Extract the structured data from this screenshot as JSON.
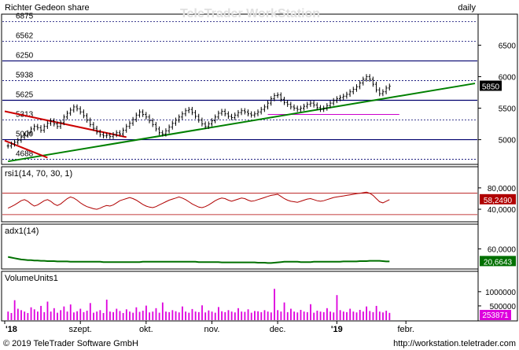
{
  "watermark": "TeleTrader WorkStation",
  "footer": {
    "copyright": "© 2019 TeleTrader Software GmbH",
    "url": "http://workstation.teletrader.com"
  },
  "colors": {
    "price_line": "#000000",
    "trend_green": "#008000",
    "trend_red": "#cc0000",
    "horiz_navy": "#00006e",
    "horiz_magenta": "#cc00cc",
    "rsi": "#b00000",
    "adx": "#007000",
    "volume": "#dd00dd"
  },
  "chart_data": [
    {
      "type": "line",
      "title": "Richter Gedeon share",
      "period": "daily",
      "x_ticks": [
        {
          "label": "'18",
          "day": 0
        },
        {
          "label": "szept.",
          "day": 23
        },
        {
          "label": "okt.",
          "day": 43
        },
        {
          "label": "nov.",
          "day": 63
        },
        {
          "label": "dec.",
          "day": 83
        },
        {
          "label": "'19",
          "day": 101
        },
        {
          "label": "febr.",
          "day": 122
        }
      ],
      "y_ticks_right": [
        5000,
        5500,
        6000,
        6500
      ],
      "ylim": [
        4620,
        6980
      ],
      "horizontal_levels": [
        {
          "label": "6875",
          "value": 6875,
          "style": "dotted"
        },
        {
          "label": "6562",
          "value": 6562,
          "style": "dotted"
        },
        {
          "label": "6250",
          "value": 6250,
          "style": "solid"
        },
        {
          "label": "5938",
          "value": 5938,
          "style": "dotted"
        },
        {
          "label": "5625",
          "value": 5625,
          "style": "solid"
        },
        {
          "label": "5313",
          "value": 5313,
          "style": "dotted"
        },
        {
          "label": "5000",
          "value": 5000,
          "style": "solid"
        },
        {
          "label": "4688",
          "value": 4688,
          "style": "dotted"
        }
      ],
      "support_line": {
        "value": 5400,
        "from_day": 80,
        "to_day": 120
      },
      "trendlines": [
        {
          "color": "green",
          "from": [
            1,
            4655
          ],
          "to": [
            143,
            5893
          ]
        },
        {
          "color": "red",
          "from": [
            0,
            5450
          ],
          "to": [
            37,
            5040
          ]
        },
        {
          "color": "red",
          "from": [
            0,
            4985
          ],
          "to": [
            13,
            4715
          ]
        }
      ],
      "last_value_label": "5850",
      "last_value": 5850,
      "closes": [
        4900,
        4930,
        4960,
        4990,
        5040,
        5070,
        5110,
        5170,
        5210,
        5190,
        5150,
        5210,
        5260,
        5300,
        5250,
        5210,
        5270,
        5360,
        5420,
        5470,
        5520,
        5490,
        5440,
        5380,
        5310,
        5240,
        5180,
        5120,
        5080,
        5060,
        5070,
        5050,
        5080,
        5110,
        5090,
        5150,
        5210,
        5260,
        5320,
        5390,
        5440,
        5400,
        5360,
        5300,
        5240,
        5170,
        5110,
        5090,
        5140,
        5200,
        5260,
        5310,
        5360,
        5410,
        5460,
        5480,
        5430,
        5370,
        5310,
        5250,
        5210,
        5250,
        5300,
        5360,
        5420,
        5450,
        5410,
        5370,
        5350,
        5390,
        5430,
        5460,
        5440,
        5410,
        5390,
        5410,
        5440,
        5480,
        5520,
        5580,
        5650,
        5700,
        5710,
        5640,
        5590,
        5560,
        5520,
        5500,
        5480,
        5500,
        5530,
        5560,
        5580,
        5550,
        5510,
        5480,
        5500,
        5540,
        5580,
        5620,
        5650,
        5670,
        5690,
        5720,
        5760,
        5800,
        5840,
        5900,
        5960,
        6000,
        5960,
        5880,
        5790,
        5730,
        5760,
        5820,
        5850
      ]
    },
    {
      "type": "line",
      "title": "rsi1(14, 70, 30, 1)",
      "y_ticks_right": [
        80,
        40
      ],
      "y_tick_labels": [
        "80,0000",
        "40,0000"
      ],
      "ylim": [
        18,
        96
      ],
      "reference_lines": [
        70,
        30
      ],
      "last_value_label": "58,2490",
      "values": [
        42,
        45,
        48,
        52,
        56,
        58,
        55,
        50,
        46,
        48,
        52,
        56,
        58,
        55,
        50,
        47,
        50,
        55,
        60,
        63,
        61,
        57,
        52,
        48,
        45,
        43,
        41,
        40,
        42,
        45,
        47,
        46,
        48,
        52,
        56,
        58,
        60,
        62,
        60,
        57,
        53,
        49,
        46,
        44,
        43,
        45,
        48,
        51,
        54,
        57,
        59,
        61,
        63,
        61,
        58,
        54,
        50,
        47,
        44,
        43,
        45,
        48,
        52,
        56,
        59,
        61,
        60,
        57,
        55,
        57,
        59,
        61,
        60,
        57,
        55,
        56,
        58,
        60,
        62,
        64,
        66,
        67,
        68,
        64,
        60,
        57,
        55,
        54,
        53,
        55,
        57,
        59,
        60,
        58,
        56,
        55,
        56,
        58,
        60,
        62,
        63,
        64,
        65,
        66,
        67,
        68,
        69,
        70,
        71,
        72,
        70,
        66,
        60,
        54,
        52,
        55,
        58
      ]
    },
    {
      "type": "line",
      "title": "adx1(14)",
      "y_ticks_right": [
        60
      ],
      "y_tick_labels": [
        "60,0000"
      ],
      "ylim": [
        0,
        100
      ],
      "last_value_label": "20,6643",
      "values": [
        35,
        33,
        31,
        29,
        27,
        26,
        25,
        25,
        24,
        24,
        23,
        23,
        22,
        22,
        22,
        21,
        21,
        21,
        21,
        20,
        20,
        20,
        20,
        20,
        20,
        20,
        20,
        20,
        20,
        19,
        19,
        19,
        19,
        19,
        19,
        19,
        19,
        19,
        19,
        19,
        19,
        20,
        20,
        20,
        20,
        20,
        20,
        20,
        20,
        20,
        20,
        20,
        20,
        20,
        20,
        20,
        20,
        20,
        19,
        19,
        19,
        19,
        19,
        19,
        19,
        18,
        18,
        18,
        18,
        18,
        18,
        18,
        18,
        18,
        18,
        18,
        17,
        17,
        17,
        16,
        16,
        17,
        18,
        19,
        20,
        20,
        20,
        20,
        20,
        19,
        19,
        19,
        19,
        20,
        20,
        20,
        20,
        20,
        20,
        20,
        20,
        20,
        21,
        21,
        21,
        21,
        21,
        22,
        22,
        22,
        23,
        23,
        23,
        23,
        22,
        21,
        21
      ]
    },
    {
      "type": "bar",
      "title": "VolumeUnits1",
      "y_ticks_right": [
        1000000,
        500000
      ],
      "y_tick_labels": [
        "1000000",
        "500000"
      ],
      "ylim": [
        0,
        1300000
      ],
      "last_value_label": "253871",
      "values": [
        300000,
        250000,
        700000,
        400000,
        350000,
        300000,
        250000,
        450000,
        380000,
        300000,
        500000,
        280000,
        650000,
        300000,
        420000,
        260000,
        350000,
        480000,
        300000,
        550000,
        270000,
        310000,
        400000,
        280000,
        330000,
        600000,
        260000,
        300000,
        350000,
        250000,
        720000,
        300000,
        280000,
        400000,
        320000,
        250000,
        380000,
        300000,
        260000,
        450000,
        290000,
        330000,
        510000,
        270000,
        300000,
        420000,
        260000,
        620000,
        300000,
        280000,
        350000,
        310000,
        270000,
        480000,
        300000,
        260000,
        390000,
        300000,
        280000,
        520000,
        270000,
        340000,
        300000,
        260000,
        460000,
        310000,
        280000,
        350000,
        300000,
        270000,
        420000,
        300000,
        290000,
        380000,
        260000,
        320000,
        310000,
        280000,
        350000,
        300000,
        270000,
        1100000,
        350000,
        300000,
        620000,
        280000,
        400000,
        300000,
        270000,
        360000,
        300000,
        280000,
        560000,
        260000,
        330000,
        300000,
        280000,
        420000,
        300000,
        270000,
        880000,
        350000,
        300000,
        280000,
        400000,
        300000,
        270000,
        360000,
        300000,
        480000,
        320000,
        280000,
        500000,
        300000,
        270000,
        330000,
        253871
      ]
    }
  ]
}
